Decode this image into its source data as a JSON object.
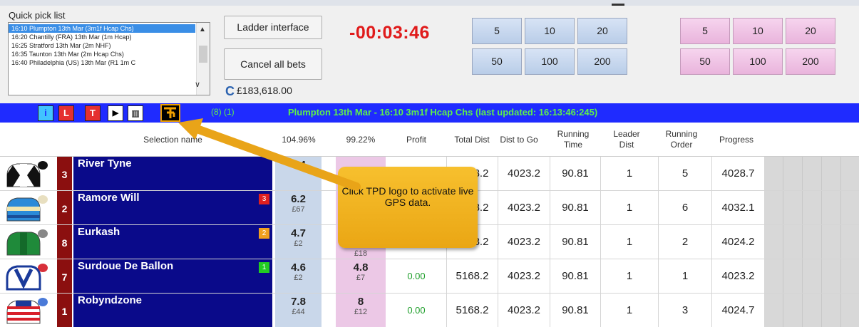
{
  "quick_pick": {
    "label": "Quick pick list",
    "items": [
      "16:10 Plumpton 13th Mar (3m1f Hcap Chs)",
      "16:20 Chantilly (FRA) 13th Mar (1m Hcap)",
      "16:25 Stratford 13th Mar (2m NHF)",
      "16:35 Taunton 13th Mar (2m Hcap Chs)",
      "16:40 Philadelphia (US) 13th Mar (R1 1m C"
    ]
  },
  "buttons": {
    "ladder": "Ladder interface",
    "cancel": "Cancel all bets"
  },
  "balance": "£183,618.00",
  "timer": "-00:03:46",
  "stakes_back": [
    "5",
    "10",
    "20",
    "50",
    "100",
    "200"
  ],
  "stakes_lay": [
    "5",
    "10",
    "20",
    "50",
    "100",
    "200"
  ],
  "race_bar": {
    "icons": [
      "i",
      "L",
      "T"
    ],
    "counts": "(8) (1)",
    "title": "Plumpton 13th Mar - 16:10 3m1f Hcap Chs (last updated: 16:13:46:245)"
  },
  "headers": {
    "selection": "Selection name",
    "back_book": "104.96%",
    "lay_book": "99.22%",
    "profit": "Profit",
    "total_dist": "Total Dist",
    "dist_to_go": "Dist to Go",
    "running_time": "Running Time",
    "leader_dist": "Leader Dist",
    "running_order": "Running Order",
    "progress": "Progress"
  },
  "runners": [
    {
      "num": "3",
      "name": "River Tyne",
      "badge": "",
      "back": "8.4",
      "back_amt": "",
      "lay": "",
      "lay_amt": "",
      "profit": "",
      "total": "5168.2",
      "togo": "4023.2",
      "time": "90.81",
      "leader": "1",
      "order": "5",
      "progress": "4028.7"
    },
    {
      "num": "2",
      "name": "Ramore Will",
      "badge": "3",
      "back": "6.2",
      "back_amt": "£67",
      "lay": "",
      "lay_amt": "",
      "profit": "",
      "total": "5168.2",
      "togo": "4023.2",
      "time": "90.81",
      "leader": "1",
      "order": "6",
      "progress": "4032.1"
    },
    {
      "num": "8",
      "name": "Eurkash",
      "badge": "2",
      "back": "4.7",
      "back_amt": "£2",
      "lay": "",
      "lay_amt": "£18",
      "profit": "",
      "total": "5168.2",
      "togo": "4023.2",
      "time": "90.81",
      "leader": "1",
      "order": "2",
      "progress": "4024.2"
    },
    {
      "num": "7",
      "name": "Surdoue De Ballon",
      "badge": "1",
      "back": "4.6",
      "back_amt": "£2",
      "lay": "4.8",
      "lay_amt": "£7",
      "profit": "0.00",
      "total": "5168.2",
      "togo": "4023.2",
      "time": "90.81",
      "leader": "1",
      "order": "1",
      "progress": "4023.2"
    },
    {
      "num": "1",
      "name": "Robyndzone",
      "badge": "",
      "back": "7.8",
      "back_amt": "£44",
      "lay": "8",
      "lay_amt": "£12",
      "profit": "0.00",
      "total": "5168.2",
      "togo": "4023.2",
      "time": "90.81",
      "leader": "1",
      "order": "3",
      "progress": "4024.7"
    }
  ],
  "callout": "Click TPD logo to activate live GPS data.",
  "colors": {
    "race_bar": "#1f2bff",
    "runner_name_bg": "#0a0a8a",
    "number_bg": "#8b0f0f",
    "back_bg": "#c9d7ea",
    "lay_bg": "#ecc8e6",
    "timer": "#e01a1a",
    "callout": "#f2b324",
    "badge_3": "#e02020",
    "badge_2": "#f0a020",
    "badge_1": "#22cc22"
  }
}
